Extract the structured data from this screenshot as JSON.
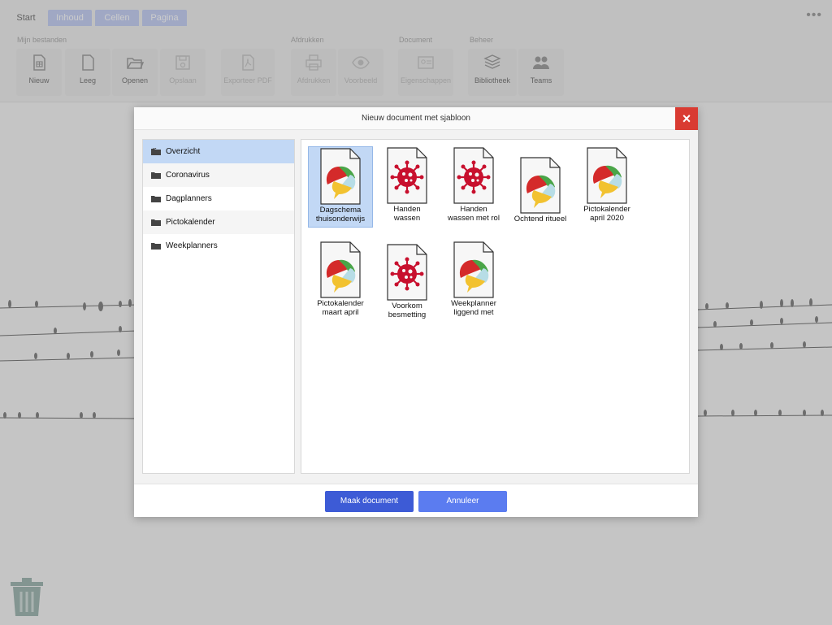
{
  "tabs": [
    {
      "label": "Start",
      "style": "plain"
    },
    {
      "label": "Inhoud",
      "style": "colored"
    },
    {
      "label": "Cellen",
      "style": "colored"
    },
    {
      "label": "Pagina",
      "style": "colored"
    }
  ],
  "ribbon": {
    "groups": [
      "Mijn bestanden",
      "Afdrukken",
      "Document",
      "Beheer"
    ],
    "buttons": {
      "nieuw": "Nieuw",
      "leeg": "Leeg",
      "openen": "Openen",
      "opslaan": "Opslaan",
      "exporteer": "Exporteer PDF",
      "afdrukken": "Afdrukken",
      "voorbeeld": "Voorbeeld",
      "eigenschappen": "Eigenschappen",
      "bibliotheek": "Bibliotheek",
      "teams": "Teams"
    }
  },
  "dialog": {
    "title": "Nieuw document met sjabloon",
    "close_icon": "×",
    "categories": [
      "Overzicht",
      "Coronavirus",
      "Dagplanners",
      "Pictokalender",
      "Weekplanners"
    ],
    "selected_category": "Overzicht",
    "templates": [
      {
        "line1": "Dagschema",
        "line2": "thuisonderwijs",
        "icon": "speech-bubble-icon",
        "selected": true
      },
      {
        "line1": "Handen",
        "line2": "wassen",
        "icon": "virus-icon"
      },
      {
        "line1": "Handen",
        "line2": "wassen met rol",
        "icon": "virus-icon"
      },
      {
        "line1": "Ochtend ritueel",
        "line2": "",
        "icon": "speech-bubble-icon"
      },
      {
        "line1": "Pictokalender",
        "line2": "april 2020",
        "icon": "speech-bubble-icon"
      },
      {
        "line1": "Pictokalender",
        "line2": "maart april",
        "icon": "speech-bubble-icon"
      },
      {
        "line1": "Voorkom",
        "line2": "besmetting",
        "icon": "virus-icon"
      },
      {
        "line1": "Weekplanner",
        "line2": "liggend met",
        "icon": "speech-bubble-icon"
      }
    ],
    "buttons": {
      "create": "Maak document",
      "cancel": "Annuleer"
    }
  },
  "colors": {
    "selection": "#c2d8f5",
    "close": "#d93b32",
    "primary_button": "#3d5bd6",
    "secondary_button": "#5b7cf0",
    "virus": "#c8102e"
  }
}
